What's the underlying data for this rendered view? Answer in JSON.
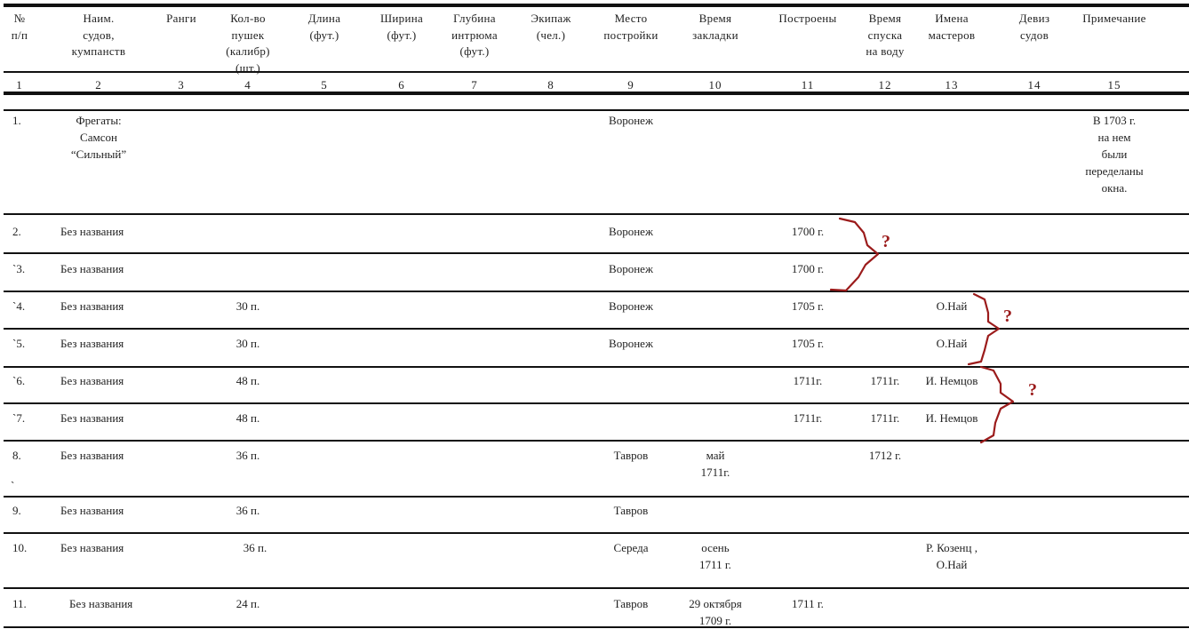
{
  "headers": [
    "№\nп/п",
    "Наим.\nсудов,\nкумпанств",
    "Ранги",
    "Кол-во\nпушек\n(калибр)\n(шт.)",
    "Длина\n(фут.)",
    "Ширина\n(фут.)",
    "Глубина\nинтрюма\n(фут.)",
    "Экипаж\n(чел.)",
    "Место\nпостройки",
    "Время\nзакладки",
    "Построены",
    "Время\nспуска\nна воду",
    "Имена\nмастеров",
    "Девиз\nсудов",
    "Примечание"
  ],
  "column_numbers": [
    "1",
    "2",
    "3",
    "4",
    "5",
    "6",
    "7",
    "8",
    "9",
    "10",
    "11",
    "12",
    "13",
    "14",
    "15"
  ],
  "rows": [
    {
      "n": "1.",
      "name": "Фрегаты:\nСамсон\n“Сильный”",
      "guns": "",
      "place": "Воронеж",
      "laid": "",
      "built": "",
      "launched": "",
      "masters": "",
      "note": "В 1703 г.\nна нем\nбыли\nпеределаны\nокна."
    },
    {
      "n": "2.",
      "name": "Без названия",
      "guns": "",
      "place": "Воронеж",
      "laid": "",
      "built": "1700 г.",
      "launched": "",
      "masters": "",
      "note": ""
    },
    {
      "n": "`3.",
      "name": "Без названия",
      "guns": "",
      "place": "Воронеж",
      "laid": "",
      "built": "1700 г.",
      "launched": "",
      "masters": "",
      "note": ""
    },
    {
      "n": "`4.",
      "name": "Без названия",
      "guns": "30 п.",
      "place": "Воронеж",
      "laid": "",
      "built": "1705 г.",
      "launched": "",
      "masters": "О.Най",
      "note": ""
    },
    {
      "n": "`5.",
      "name": "Без названия",
      "guns": "30 п.",
      "place": "Воронеж",
      "laid": "",
      "built": "1705 г.",
      "launched": "",
      "masters": "О.Най",
      "note": ""
    },
    {
      "n": "`6.",
      "name": "Без названия",
      "guns": "48 п.",
      "place": "",
      "laid": "",
      "built": "1711г.",
      "launched": "1711г.",
      "masters": "И. Немцов",
      "note": ""
    },
    {
      "n": "`7.",
      "name": "Без названия",
      "guns": "48 п.",
      "place": "",
      "laid": "",
      "built": "1711г.",
      "launched": "1711г.",
      "masters": "И. Немцов",
      "note": ""
    },
    {
      "n": "8.",
      "name": "Без названия",
      "guns": "36 п.",
      "place": "Тавров",
      "laid": "май\n1711г.",
      "built": "",
      "launched": "1712 г.",
      "masters": "",
      "note": "",
      "extra_mark": "`"
    },
    {
      "n": "9.",
      "name": "Без названия",
      "guns": "36 п.",
      "place": "Тавров",
      "laid": "",
      "built": "",
      "launched": "",
      "masters": "",
      "note": ""
    },
    {
      "n": "10.",
      "name": "Без названия",
      "guns": "36 п.",
      "place": "Середа",
      "laid": "осень\n1711 г.",
      "built": "",
      "launched": "",
      "masters": "Р. Козенц ,\nО.Най",
      "note": ""
    },
    {
      "n": "11.",
      "name": "Без названия",
      "guns": "24 п.",
      "place": "Тавров",
      "laid": "29 октября\n1709 г.",
      "built": "1711 г.",
      "launched": "",
      "masters": "",
      "note": ""
    }
  ],
  "annotations": {
    "question_mark": "?",
    "color": "#9b1b1b"
  }
}
